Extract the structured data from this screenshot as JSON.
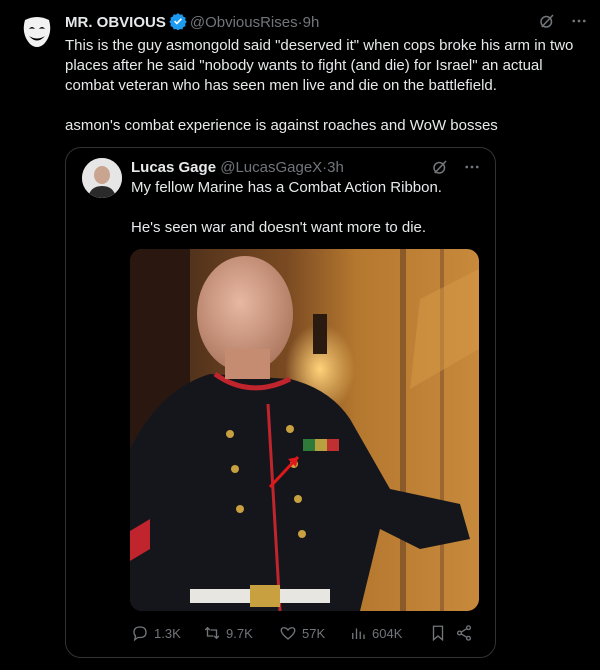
{
  "post": {
    "author_name": "MR. OBVIOUS",
    "handle": "@ObviousRises",
    "separator": "·",
    "time": "9h",
    "text_p1": "This is the guy asmongold said \"deserved it\" when cops broke his arm in two places after he said \"nobody wants to fight (and die) for Israel\" an actual combat veteran who has seen men live and die on the battlefield.",
    "text_p2": "asmon's combat experience is against roaches and WoW bosses"
  },
  "quote": {
    "author_name": "Lucas Gage",
    "handle": "@LucasGageX",
    "separator": "·",
    "time": "3h",
    "text_p1": "My fellow Marine has a Combat Action Ribbon.",
    "text_p2": "He's seen war and doesn't want more to die.",
    "stats": {
      "replies": "1.3K",
      "reposts": "9.7K",
      "likes": "57K",
      "views": "604K"
    }
  },
  "icons": {
    "verified": "verified-badge-icon",
    "grok": "grok-icon",
    "more": "more-icon",
    "reply": "reply-icon",
    "repost": "repost-icon",
    "like": "like-icon",
    "views": "views-icon",
    "bookmark": "bookmark-icon",
    "share": "share-icon"
  },
  "colors": {
    "background": "#000000",
    "text": "#e7e9ea",
    "muted": "#71767b",
    "verified": "#1d9bf0",
    "border": "#2f3336"
  }
}
